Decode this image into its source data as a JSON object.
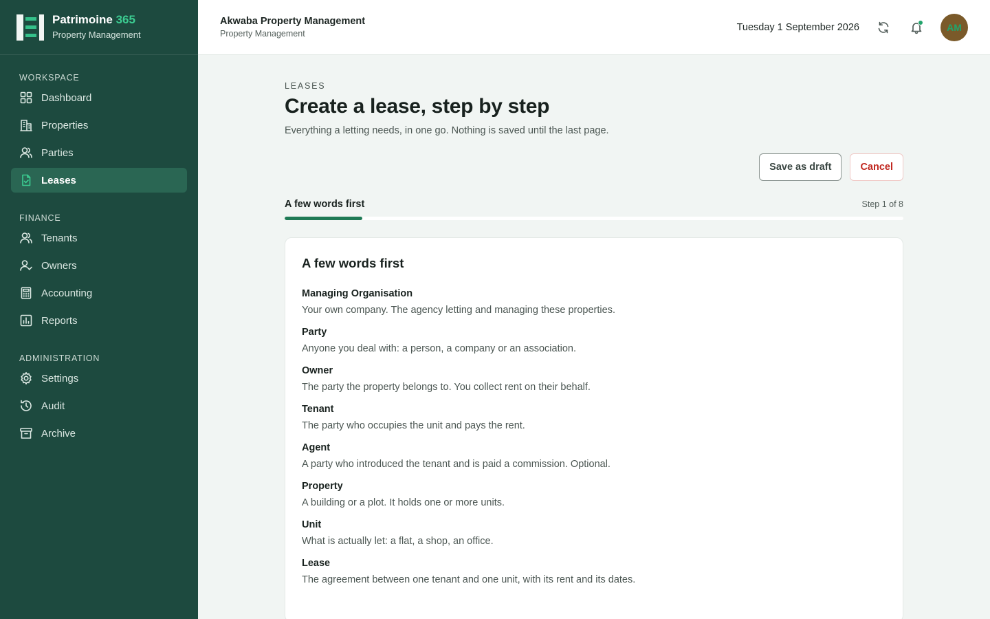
{
  "brand": {
    "name": "Patrimoine",
    "name_accent": "365",
    "subtitle": "Property Management"
  },
  "sidebar": {
    "sections": [
      {
        "heading": "WORKSPACE",
        "items": [
          {
            "label": "Dashboard",
            "icon": "dashboard-icon",
            "active": false
          },
          {
            "label": "Properties",
            "icon": "building-icon",
            "active": false
          },
          {
            "label": "Parties",
            "icon": "users-icon",
            "active": false
          },
          {
            "label": "Leases",
            "icon": "document-check-icon",
            "active": true
          }
        ]
      },
      {
        "heading": "FINANCE",
        "items": [
          {
            "label": "Tenants",
            "icon": "users-icon",
            "active": false
          },
          {
            "label": "Owners",
            "icon": "user-check-icon",
            "active": false
          },
          {
            "label": "Accounting",
            "icon": "calculator-icon",
            "active": false
          },
          {
            "label": "Reports",
            "icon": "bar-chart-icon",
            "active": false
          }
        ]
      },
      {
        "heading": "ADMINISTRATION",
        "items": [
          {
            "label": "Settings",
            "icon": "gear-icon",
            "active": false
          },
          {
            "label": "Audit",
            "icon": "history-icon",
            "active": false
          },
          {
            "label": "Archive",
            "icon": "archive-icon",
            "active": false
          }
        ]
      }
    ]
  },
  "header": {
    "org_name": "Akwaba Property Management",
    "org_subtitle": "Property Management",
    "date": "Tuesday 1 September 2026",
    "avatar_initials": "AM"
  },
  "page": {
    "eyebrow": "LEASES",
    "title": "Create a lease, step by step",
    "subtitle": "Everything a letting needs, in one go. Nothing is saved until the last page.",
    "save_draft_label": "Save as draft",
    "cancel_label": "Cancel",
    "step_title": "A few words first",
    "step_count": "Step 1 of 8",
    "progress_fraction": 0.125
  },
  "card": {
    "title": "A few words first",
    "terms": [
      {
        "name": "Managing Organisation",
        "definition": "Your own company. The agency letting and managing these properties."
      },
      {
        "name": "Party",
        "definition": "Anyone you deal with: a person, a company or an association."
      },
      {
        "name": "Owner",
        "definition": "The party the property belongs to. You collect rent on their behalf."
      },
      {
        "name": "Tenant",
        "definition": "The party who occupies the unit and pays the rent."
      },
      {
        "name": "Agent",
        "definition": "A party who introduced the tenant and is paid a commission. Optional."
      },
      {
        "name": "Property",
        "definition": "A building or a plot. It holds one or more units."
      },
      {
        "name": "Unit",
        "definition": "What is actually let: a flat, a shop, an office."
      },
      {
        "name": "Lease",
        "definition": "The agreement between one tenant and one unit, with its rent and its dates."
      }
    ]
  },
  "colors": {
    "sidebar_bg": "#1d4a3f",
    "accent": "#3ccd92",
    "progress": "#1f7a55",
    "danger": "#c0271f"
  }
}
